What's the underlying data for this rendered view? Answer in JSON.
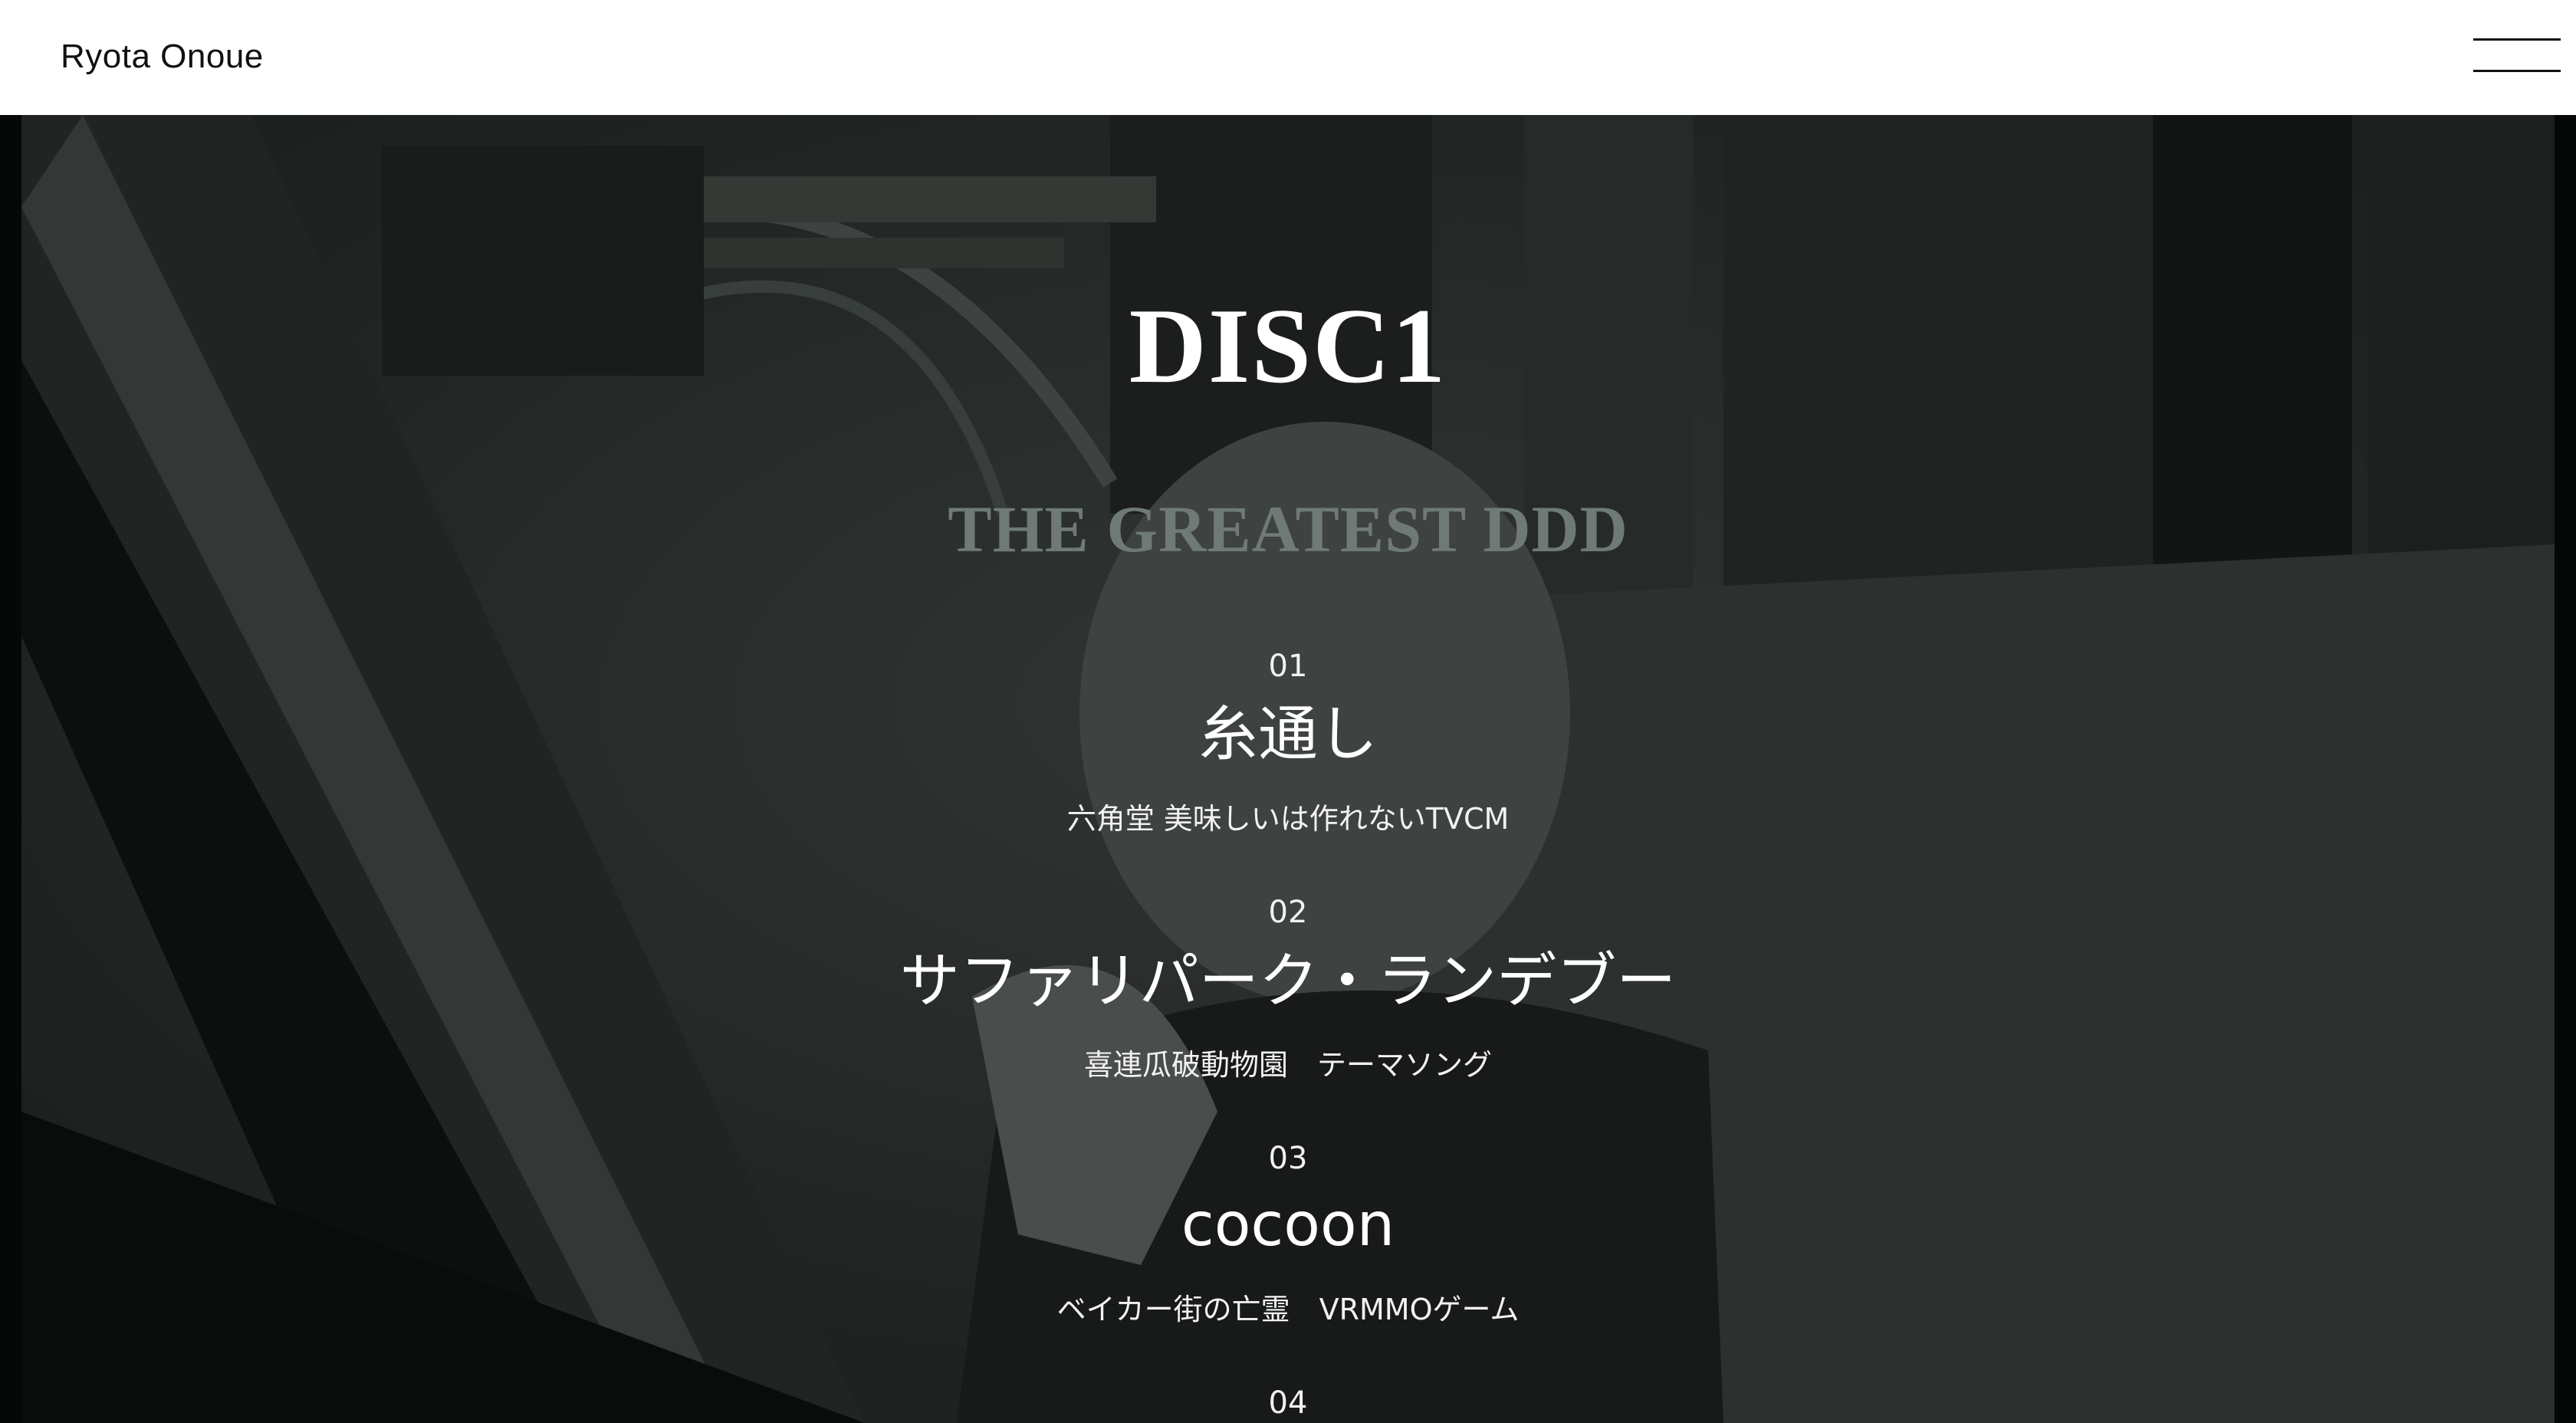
{
  "header": {
    "site_title": "Ryota Onoue",
    "menu_icon": "hamburger-menu-icon"
  },
  "hero": {
    "disc_title": "DISC1",
    "album_title": "THE GREATEST DDD",
    "background_description_color": "#2a2e2d",
    "tracks": [
      {
        "number": "01",
        "title": "糸通し",
        "subtitle": "六角堂 美味しいは作れないTVCM"
      },
      {
        "number": "02",
        "title": "サファリパーク・ランデブー",
        "subtitle": "喜連瓜破動物園　テーマソング"
      },
      {
        "number": "03",
        "title": "cocoon",
        "subtitle": "ベイカー街の亡霊　VRMMOゲーム"
      },
      {
        "number": "04"
      }
    ]
  },
  "colors": {
    "header_bg": "#ffffff",
    "album_title": "#6f7a78",
    "text": "#ffffff"
  }
}
